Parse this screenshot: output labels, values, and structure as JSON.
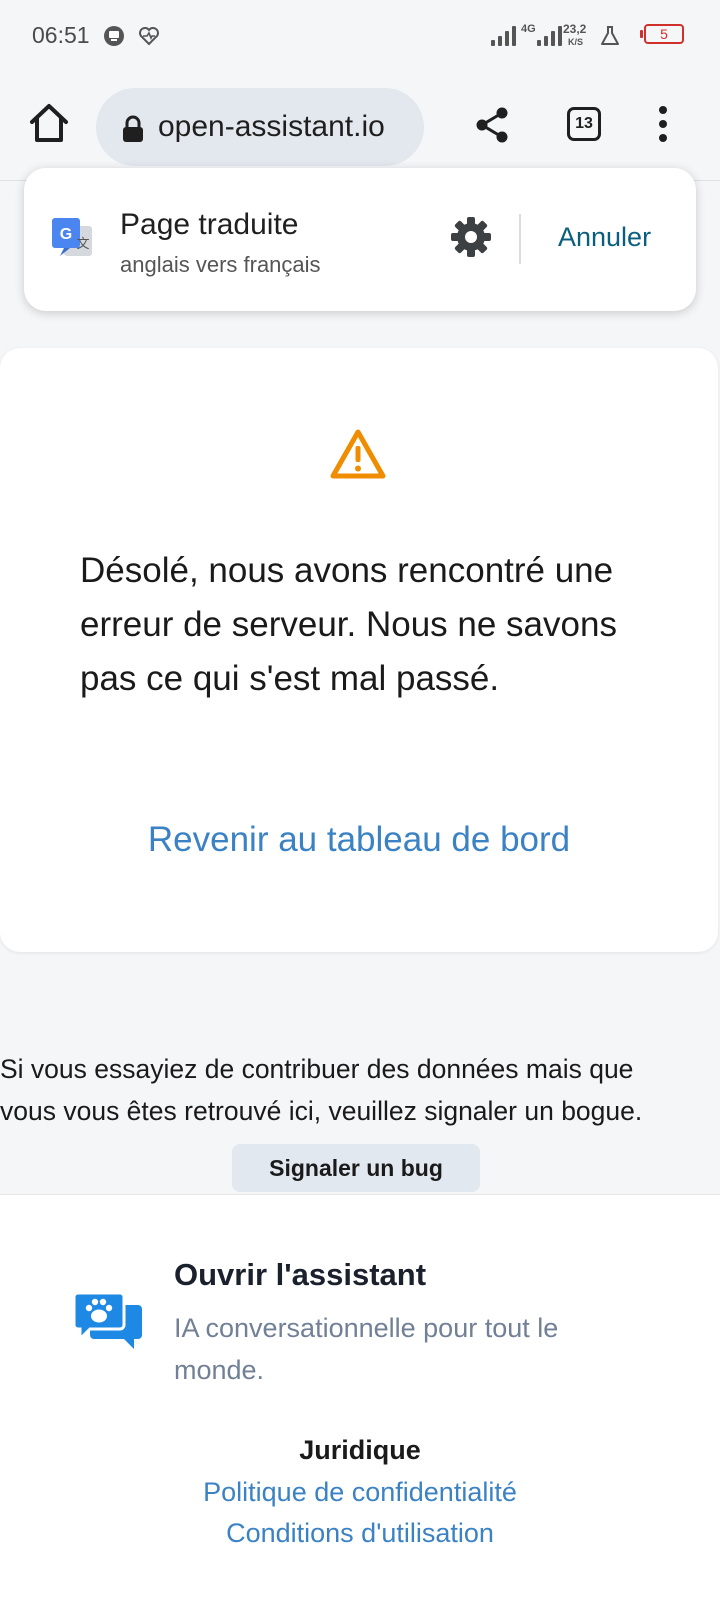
{
  "status_bar": {
    "time": "06:51",
    "network_type": "4G",
    "speed_value": "23,2",
    "speed_unit": "K/S",
    "battery": "5"
  },
  "browser": {
    "url": "open-assistant.io",
    "tab_count": "13"
  },
  "translate_bar": {
    "title": "Page traduite",
    "subtitle": "anglais vers français",
    "cancel_label": "Annuler"
  },
  "error_card": {
    "message": "Désolé, nous avons rencontré une erreur de serveur. Nous ne savons pas ce qui s'est mal passé.",
    "dashboard_link": "Revenir au tableau de bord"
  },
  "bug_report": {
    "line1": "Si vous essayiez de contribuer des données mais que",
    "line2": "vous vous êtes retrouvé ici, veuillez signaler un bogue.",
    "button_label": "Signaler un bug"
  },
  "footer": {
    "brand": "Ouvrir l'assistant",
    "tagline": "IA conversationnelle pour tout le monde.",
    "legal_heading": "Juridique",
    "privacy_link": "Politique de confidentialité",
    "terms_link": "Conditions d'utilisation"
  },
  "colors": {
    "link": "#3b82c4",
    "warning": "#f08c00",
    "translate_action": "#0b5f7e",
    "brand_logo": "#1e88e5"
  }
}
